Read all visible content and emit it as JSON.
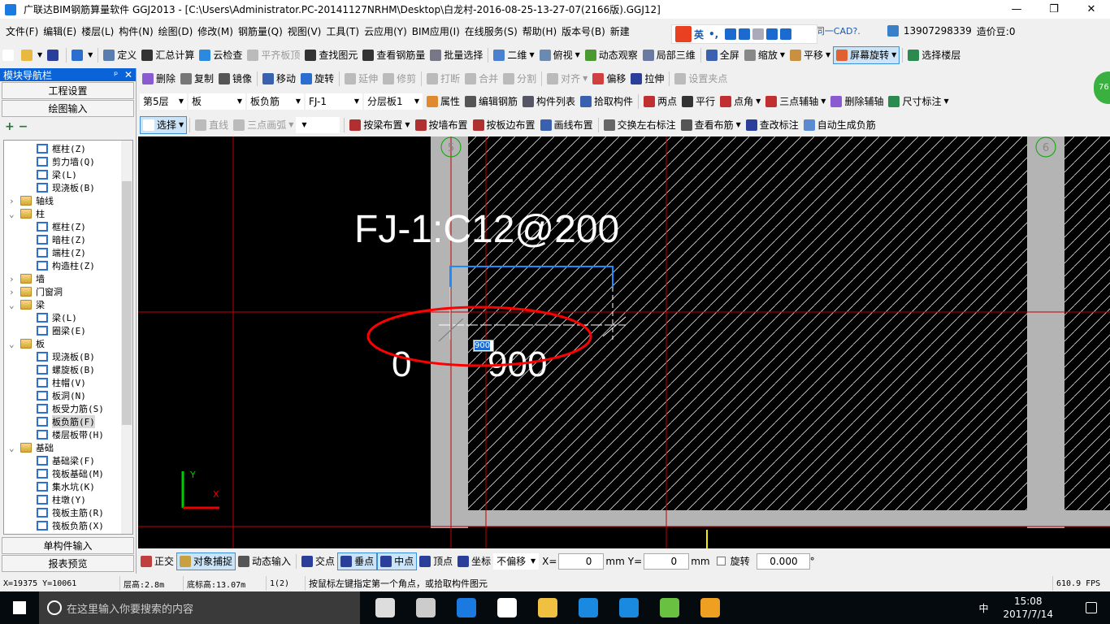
{
  "title": "广联达BIM钢筋算量软件 GGJ2013 - [C:\\Users\\Administrator.PC-20141127NRHM\\Desktop\\白龙村-2016-08-25-13-27-07(2166版).GGJ12]",
  "window_controls": [
    "—",
    "❐",
    "✕"
  ],
  "menu": [
    "文件(F)",
    "编辑(E)",
    "楼层(L)",
    "构件(N)",
    "绘图(D)",
    "修改(M)",
    "钢筋量(Q)",
    "视图(V)",
    "工具(T)",
    "云应用(Y)",
    "BIM应用(I)",
    "在线服务(S)",
    "帮助(H)",
    "版本号(B)",
    "新建"
  ],
  "menu_right": {
    "ad": "…删除同一CAD?.",
    "user": "13907298339",
    "beans": "造价豆:0"
  },
  "ime": {
    "lang": "英",
    "punct": "•,"
  },
  "toolbar1": [
    {
      "label": "",
      "icon": "new-file-icon",
      "color": "#fff"
    },
    {
      "label": "",
      "icon": "open-folder-icon",
      "color": "#e8b840",
      "dd": true
    },
    {
      "label": "",
      "icon": "save-icon",
      "color": "#2a3f9a"
    },
    {
      "sep": true
    },
    {
      "label": "",
      "icon": "undo-icon",
      "color": "#2a6fd0",
      "dd": true
    },
    {
      "sep": true
    },
    {
      "label": "定义",
      "icon": "define-icon",
      "color": "#5a7db0"
    },
    {
      "label": "汇总计算",
      "icon": "sigma-icon",
      "color": "#333"
    },
    {
      "label": "云检查",
      "icon": "cloud-check-icon",
      "color": "#2a8ae0"
    },
    {
      "label": "平齐板顶",
      "icon": "align-top-icon",
      "color": "#bbb",
      "dis": true
    },
    {
      "label": "查找图元",
      "icon": "binoculars-icon",
      "color": "#333"
    },
    {
      "label": "查看钢筋量",
      "icon": "rebar-view-icon",
      "color": "#333"
    },
    {
      "label": "批量选择",
      "icon": "batch-select-icon",
      "color": "#778"
    },
    {
      "sep": true
    },
    {
      "label": "二维",
      "icon": "2d-icon",
      "color": "#4a80d0",
      "dd": true
    },
    {
      "label": "俯视",
      "icon": "top-view-icon",
      "color": "#6a8ab0",
      "dd": true
    },
    {
      "label": "动态观察",
      "icon": "orbit-icon",
      "color": "#4a9a30"
    },
    {
      "label": "局部三维",
      "icon": "local-3d-icon",
      "color": "#6a7aa0"
    },
    {
      "sep": true
    },
    {
      "label": "全屏",
      "icon": "fullscreen-icon",
      "color": "#3a60b0"
    },
    {
      "label": "缩放",
      "icon": "zoom-icon",
      "color": "#888",
      "dd": true
    },
    {
      "label": "平移",
      "icon": "pan-icon",
      "color": "#c89040",
      "dd": true
    },
    {
      "label": "屏幕旋转",
      "icon": "screen-rotate-icon",
      "color": "#e06030",
      "dd": true,
      "act": true
    },
    {
      "sep": true
    },
    {
      "label": "选择楼层",
      "icon": "select-floor-icon",
      "color": "#2a8a50"
    }
  ],
  "toolbar2": [
    {
      "label": "删除",
      "icon": "delete-icon",
      "color": "#8a5ad0"
    },
    {
      "label": "复制",
      "icon": "copy-icon",
      "color": "#777"
    },
    {
      "label": "镜像",
      "icon": "mirror-icon",
      "color": "#555"
    },
    {
      "sep": true
    },
    {
      "label": "移动",
      "icon": "move-icon",
      "color": "#3a60b0"
    },
    {
      "label": "旋转",
      "icon": "rotate-icon",
      "color": "#2a6fd0"
    },
    {
      "sep": true
    },
    {
      "label": "延伸",
      "icon": "extend-icon",
      "color": "#bbb",
      "dis": true
    },
    {
      "label": "修剪",
      "icon": "trim-icon",
      "color": "#bbb",
      "dis": true
    },
    {
      "sep": true
    },
    {
      "label": "打断",
      "icon": "break-icon",
      "color": "#bbb",
      "dis": true
    },
    {
      "label": "合并",
      "icon": "merge-icon",
      "color": "#bbb",
      "dis": true
    },
    {
      "label": "分割",
      "icon": "split-icon",
      "color": "#bbb",
      "dis": true
    },
    {
      "sep": true
    },
    {
      "label": "对齐",
      "icon": "align-icon",
      "color": "#bbb",
      "dis": true,
      "dd": true
    },
    {
      "label": "偏移",
      "icon": "offset-icon",
      "color": "#d04040"
    },
    {
      "label": "拉伸",
      "icon": "stretch-icon",
      "color": "#2a3f9a"
    },
    {
      "sep": true
    },
    {
      "label": "设置夹点",
      "icon": "grip-icon",
      "color": "#bbb",
      "dis": true
    }
  ],
  "toolbar3": {
    "combos": [
      {
        "value": "第5层",
        "w": 58
      },
      {
        "value": "板",
        "w": 70
      },
      {
        "value": "板负筋",
        "w": 70
      },
      {
        "value": "FJ-1",
        "w": 70
      },
      {
        "value": "分层板1",
        "w": 72
      }
    ],
    "items": [
      {
        "label": "属性",
        "icon": "properties-icon",
        "color": "#e08a30"
      },
      {
        "label": "编辑钢筋",
        "icon": "edit-rebar-icon",
        "color": "#555"
      },
      {
        "label": "构件列表",
        "icon": "component-list-icon",
        "color": "#556"
      },
      {
        "label": "拾取构件",
        "icon": "pick-component-icon",
        "color": "#3a60b0"
      },
      {
        "sep": true
      },
      {
        "label": "两点",
        "icon": "two-point-icon",
        "color": "#c03030"
      },
      {
        "label": "平行",
        "icon": "parallel-icon",
        "color": "#333"
      },
      {
        "label": "点角",
        "icon": "point-angle-icon",
        "color": "#c03030",
        "dd": true
      },
      {
        "label": "三点辅轴",
        "icon": "three-point-axis-icon",
        "color": "#c03030",
        "dd": true
      },
      {
        "label": "删除辅轴",
        "icon": "delete-axis-icon",
        "color": "#8a5ad0"
      },
      {
        "label": "尺寸标注",
        "icon": "dimension-icon",
        "color": "#2a8a50",
        "dd": true
      }
    ]
  },
  "toolbar4": [
    {
      "label": "选择",
      "icon": "select-cursor-icon",
      "color": "#fff",
      "dd": true,
      "act": true
    },
    {
      "sep": true
    },
    {
      "label": "直线",
      "icon": "line-icon",
      "color": "#bbb",
      "dis": true
    },
    {
      "label": "三点画弧",
      "icon": "arc-icon",
      "color": "#bbb",
      "dis": true,
      "dd": true
    },
    {
      "combo": ""
    },
    {
      "sep": true
    },
    {
      "label": "按梁布置",
      "icon": "place-by-beam-icon",
      "color": "#b03030",
      "dd": true
    },
    {
      "label": "按墙布置",
      "icon": "place-by-wall-icon",
      "color": "#b03030"
    },
    {
      "label": "按板边布置",
      "icon": "place-by-slab-edge-icon",
      "color": "#b03030"
    },
    {
      "label": "画线布置",
      "icon": "draw-line-place-icon",
      "color": "#3a60b0"
    },
    {
      "sep": true
    },
    {
      "label": "交换左右标注",
      "icon": "swap-label-icon",
      "color": "#666"
    },
    {
      "label": "查看布筋",
      "icon": "view-rebar-icon",
      "color": "#555",
      "dd": true
    },
    {
      "label": "查改标注",
      "icon": "edit-label-icon",
      "color": "#2a3f9a"
    },
    {
      "label": "自动生成负筋",
      "icon": "auto-negative-rebar-icon",
      "color": "#5a8ad0"
    }
  ],
  "left_panel": {
    "title": "模块导航栏",
    "pin": "ᵖ",
    "close": "✕",
    "btn_project": "工程设置",
    "btn_draw": "绘图输入",
    "btn_single": "单构件输入",
    "btn_report": "报表预览",
    "tools": [
      "+",
      "−"
    ]
  },
  "tree": [
    {
      "label": "框柱(Z)",
      "lvl": 2
    },
    {
      "label": "剪力墙(Q)",
      "lvl": 2
    },
    {
      "label": "梁(L)",
      "lvl": 2
    },
    {
      "label": "现浇板(B)",
      "lvl": 2
    },
    {
      "label": "轴线",
      "lvl": 1,
      "folder": true,
      "exp": "›"
    },
    {
      "label": "柱",
      "lvl": 1,
      "folder": true,
      "exp": "⌄"
    },
    {
      "label": "框柱(Z)",
      "lvl": 2
    },
    {
      "label": "暗柱(Z)",
      "lvl": 2
    },
    {
      "label": "端柱(Z)",
      "lvl": 2
    },
    {
      "label": "构造柱(Z)",
      "lvl": 2
    },
    {
      "label": "墙",
      "lvl": 1,
      "folder": true,
      "exp": "›"
    },
    {
      "label": "门窗洞",
      "lvl": 1,
      "folder": true,
      "exp": "›"
    },
    {
      "label": "梁",
      "lvl": 1,
      "folder": true,
      "exp": "⌄"
    },
    {
      "label": "梁(L)",
      "lvl": 2
    },
    {
      "label": "圈梁(E)",
      "lvl": 2
    },
    {
      "label": "板",
      "lvl": 1,
      "folder": true,
      "exp": "⌄"
    },
    {
      "label": "现浇板(B)",
      "lvl": 2
    },
    {
      "label": "螺旋板(B)",
      "lvl": 2
    },
    {
      "label": "柱帽(V)",
      "lvl": 2
    },
    {
      "label": "板洞(N)",
      "lvl": 2
    },
    {
      "label": "板受力筋(S)",
      "lvl": 2
    },
    {
      "label": "板负筋(F)",
      "lvl": 2,
      "sel": true
    },
    {
      "label": "楼层板带(H)",
      "lvl": 2
    },
    {
      "label": "基础",
      "lvl": 1,
      "folder": true,
      "exp": "⌄"
    },
    {
      "label": "基础梁(F)",
      "lvl": 2
    },
    {
      "label": "筏板基础(M)",
      "lvl": 2
    },
    {
      "label": "集水坑(K)",
      "lvl": 2
    },
    {
      "label": "柱墩(Y)",
      "lvl": 2
    },
    {
      "label": "筏板主筋(R)",
      "lvl": 2
    },
    {
      "label": "筏板负筋(X)",
      "lvl": 2
    }
  ],
  "canvas": {
    "axis_left": "5",
    "axis_right": "6",
    "label": "FJ-1:C12@200",
    "left_len": "0",
    "right_len": "900",
    "input_value": "900",
    "y_axis": "Y",
    "x_axis": "X",
    "badge": "76"
  },
  "bottombar": {
    "items": [
      {
        "label": "正交",
        "icon": "ortho-icon",
        "color": "#c04040"
      },
      {
        "label": "对象捕捉",
        "icon": "object-snap-icon",
        "color": "#c8a040",
        "act": true
      },
      {
        "label": "动态输入",
        "icon": "dynamic-input-icon",
        "color": "#555"
      },
      {
        "sep": true
      },
      {
        "label": "交点",
        "icon": "intersection-icon",
        "color": "#2a3f9a"
      },
      {
        "label": "垂点",
        "icon": "perpendicular-icon",
        "color": "#2a3f9a",
        "act": true
      },
      {
        "label": "中点",
        "icon": "midpoint-icon",
        "color": "#2a3f9a",
        "act": true
      },
      {
        "label": "顶点",
        "icon": "vertex-icon",
        "color": "#2a3f9a"
      },
      {
        "label": "坐标",
        "icon": "coordinate-icon",
        "color": "#2a3f9a"
      }
    ],
    "offset": "不偏移",
    "x_label": "X=",
    "x": "0",
    "mm1": "mm",
    "y_label": "Y=",
    "y": "0",
    "mm2": "mm",
    "rotate_label": "旋转",
    "rotate": "0.000",
    "deg": "°"
  },
  "status": {
    "coords": "X=19375 Y=10061",
    "floor_height": "层高:2.8m",
    "bottom_elev": "底标高:13.07m",
    "count": "1(2)",
    "hint": "按鼠标左键指定第一个角点，或拾取构件图元",
    "fps": "610.9 FPS"
  },
  "taskbar": {
    "search_placeholder": "在这里输入你要搜索的内容",
    "time": "15:08",
    "date": "2017/7/14",
    "ime": "中",
    "apps": [
      "#ddd",
      "#ccc",
      "#1a7ae0",
      "#fff",
      "#f0c040",
      "#1a8ae0",
      "#1a8ae0",
      "#6ac040",
      "#f0a020"
    ]
  }
}
